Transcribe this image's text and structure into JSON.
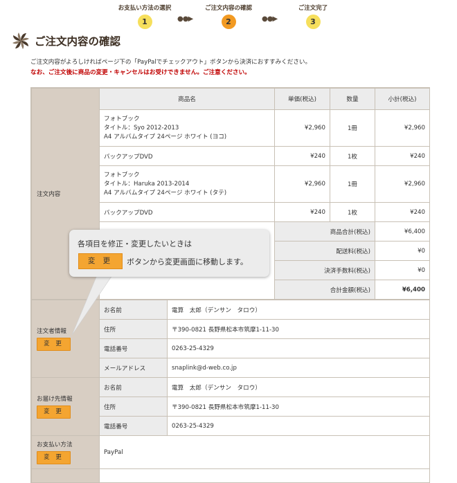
{
  "steps": [
    {
      "label": "お支払い方法の選択",
      "num": "1"
    },
    {
      "label": "ご注文内容の確認",
      "num": "2"
    },
    {
      "label": "ご注文完了",
      "num": "3"
    }
  ],
  "step_dots": "●●▶",
  "page_title": "ご注文内容の確認",
  "intro": {
    "line1": "ご注文内容がよろしければページ下の「PayPalでチェックアウト」ボタンから決済におすすみください。",
    "warning": "なお、ご注文後に商品の変更・キャンセルはお受けできません。ご注意ください。"
  },
  "order": {
    "section_label": "注文内容",
    "headers": {
      "name": "商品名",
      "price": "単価(税込)",
      "qty": "数量",
      "subtotal": "小計(税込)"
    },
    "items": [
      {
        "line1": "フォトブック",
        "line2": "タイトル：Syo 2012-2013",
        "line3": "A4 アルバムタイプ 24ページ ホワイト (ヨコ)",
        "price": "¥2,960",
        "qty": "1冊",
        "subtotal": "¥2,960"
      },
      {
        "line1": "バックアップDVD",
        "line2": "",
        "line3": "",
        "price": "¥240",
        "qty": "1枚",
        "subtotal": "¥240"
      },
      {
        "line1": "フォトブック",
        "line2": "タイトル：Haruka 2013-2014",
        "line3": "A4 アルバムタイプ 24ページ ホワイト (タテ)",
        "price": "¥2,960",
        "qty": "1冊",
        "subtotal": "¥2,960"
      },
      {
        "line1": "バックアップDVD",
        "line2": "",
        "line3": "",
        "price": "¥240",
        "qty": "1枚",
        "subtotal": "¥240"
      }
    ],
    "totals": [
      {
        "label": "商品合計(税込)",
        "value": "¥6,400"
      },
      {
        "label": "配送料(税込)",
        "value": "¥0"
      },
      {
        "label": "決済手数料(税込)",
        "value": "¥0"
      },
      {
        "label": "合計金額(税込)",
        "value": "¥6,400"
      }
    ]
  },
  "orderer": {
    "section_label": "注文者情報",
    "edit_label": "変 更",
    "rows": [
      {
        "label": "お名前",
        "value": "電算　太郎（デンサン　タロウ）"
      },
      {
        "label": "住所",
        "value": "〒390-0821 長野県松本市筑摩1-11-30"
      },
      {
        "label": "電話番号",
        "value": "0263-25-4329"
      },
      {
        "label": "メールアドレス",
        "value": "snaplink@d-web.co.jp"
      }
    ]
  },
  "delivery": {
    "section_label": "お届け先情報",
    "edit_label": "変 更",
    "rows": [
      {
        "label": "お名前",
        "value": "電算　太郎（デンサン　タロウ）"
      },
      {
        "label": "住所",
        "value": "〒390-0821 長野県松本市筑摩1-11-30"
      },
      {
        "label": "電話番号",
        "value": "0263-25-4329"
      }
    ]
  },
  "payment": {
    "section_label": "お支払い方法",
    "edit_label": "変 更",
    "value": "PayPal"
  },
  "callout": {
    "line1": "各項目を修正・変更したいときは",
    "button": "変 更",
    "line2": "ボタンから変更画面に移動します。"
  },
  "colors": {
    "accent_orange": "#f4a531",
    "step_yellow": "#f6df5c",
    "warning_red": "#c00000",
    "side_bg": "#d8cec3"
  }
}
